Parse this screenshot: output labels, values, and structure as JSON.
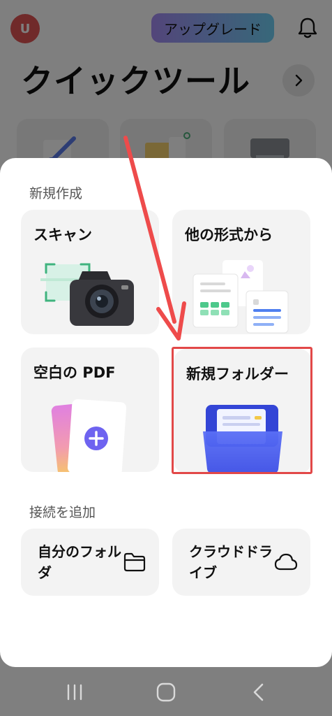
{
  "header": {
    "avatar_initial": "U",
    "upgrade_label": "アップグレード",
    "quick_tools_title": "クイックツール"
  },
  "sheet": {
    "new_section_label": "新規作成",
    "cards": [
      {
        "label": "スキャン"
      },
      {
        "label": "他の形式から"
      },
      {
        "label": "空白の PDF"
      },
      {
        "label": "新規フォルダー"
      }
    ],
    "connect_section_label": "接続を追加",
    "connections": [
      {
        "label": "自分のフォルダ"
      },
      {
        "label": "クラウドドライブ"
      }
    ]
  },
  "colors": {
    "highlight": "#e24848",
    "arrow": "#ee4b4b",
    "folder_blue": "#4a5ff0",
    "plus_purple": "#6e63f0"
  },
  "icons": [
    "bell-icon",
    "chevron-right-icon",
    "folder-icon",
    "cloud-icon",
    "camera-icon",
    "plus-icon",
    "recents-icon",
    "home-icon",
    "back-icon"
  ]
}
